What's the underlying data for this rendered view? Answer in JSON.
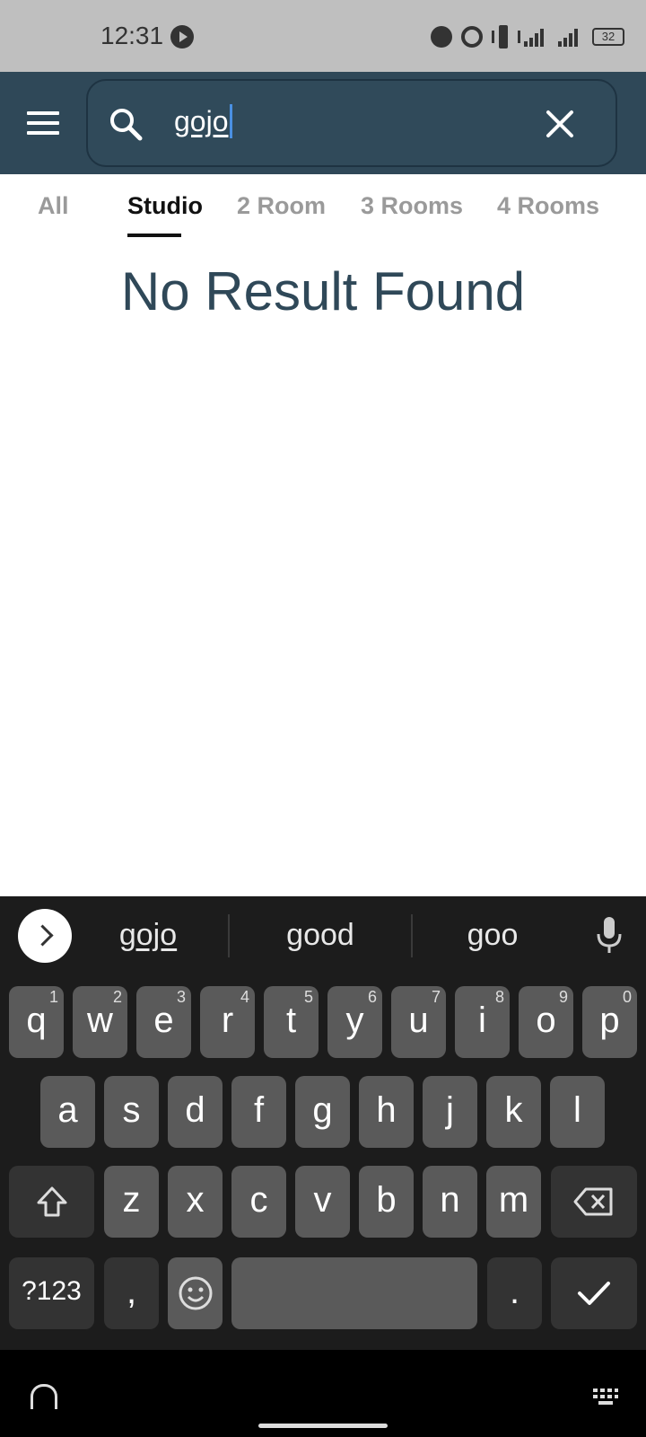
{
  "status_bar": {
    "time": "12:31",
    "battery": "32"
  },
  "search": {
    "query": "gojo"
  },
  "tabs": [
    "All",
    "Studio",
    "2 Room",
    "3 Rooms",
    "4 Rooms"
  ],
  "active_tab": "Studio",
  "empty_state": "No Result Found",
  "keyboard": {
    "suggestions": [
      "gojo",
      "good",
      "goo"
    ],
    "row1": [
      "q",
      "w",
      "e",
      "r",
      "t",
      "y",
      "u",
      "i",
      "o",
      "p"
    ],
    "row1_hints": [
      "1",
      "2",
      "3",
      "4",
      "5",
      "6",
      "7",
      "8",
      "9",
      "0"
    ],
    "row2": [
      "a",
      "s",
      "d",
      "f",
      "g",
      "h",
      "j",
      "k",
      "l"
    ],
    "row3": [
      "z",
      "x",
      "c",
      "v",
      "b",
      "n",
      "m"
    ],
    "symbols_key": "?123",
    "comma_key": ",",
    "period_key": "."
  },
  "colors": {
    "header": "#2f4858",
    "keyboard_bg": "#1c1c1c",
    "key": "#5a5a5a",
    "accent": "#4a90e2"
  }
}
